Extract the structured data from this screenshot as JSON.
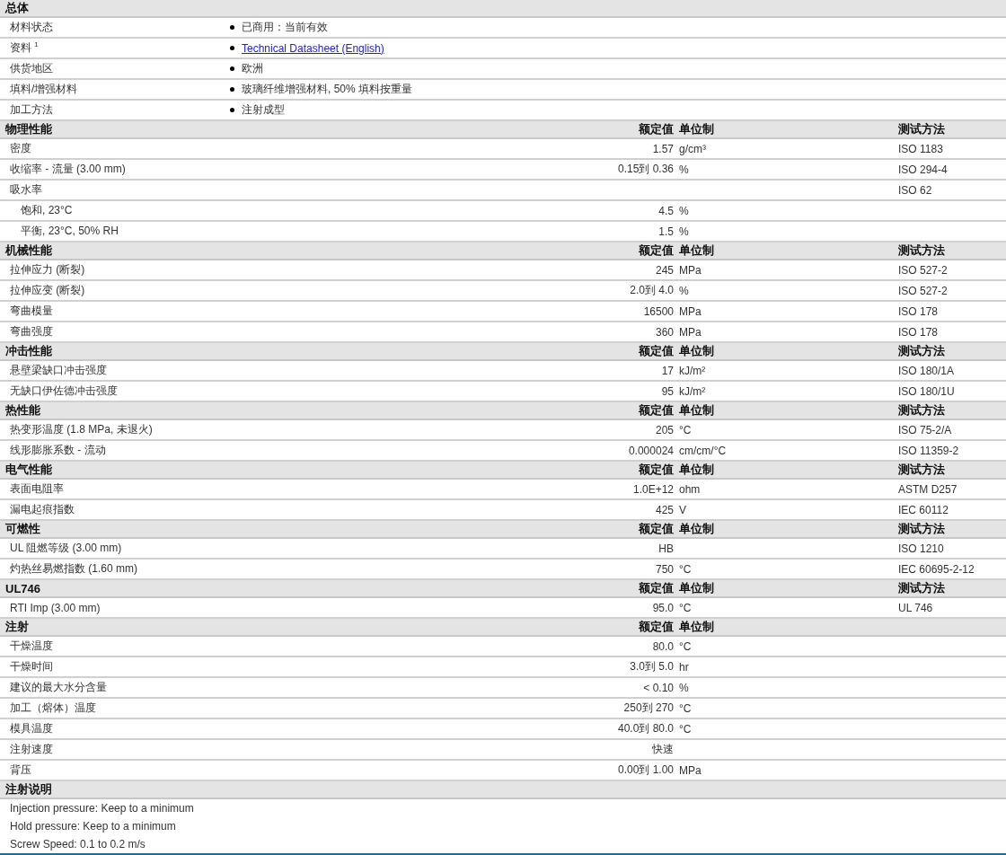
{
  "sections": [
    {
      "kind": "general",
      "title": "总体",
      "rows": [
        {
          "label": "材料状态",
          "value": "已商用：当前有效",
          "kind": "text"
        },
        {
          "label": "资料 $^{1}$",
          "value": "Technical Datasheet (English)",
          "kind": "link"
        },
        {
          "label": "供货地区",
          "value": "欧洲",
          "kind": "text"
        },
        {
          "label": "填料/增强材料",
          "value": "玻璃纤维增强材料, 50% 填料按重量",
          "kind": "text"
        },
        {
          "label": "加工方法",
          "value": "注射成型",
          "kind": "text"
        }
      ]
    },
    {
      "kind": "properties",
      "title": "物理性能",
      "headers": {
        "value": "额定值",
        "unit": "单位制",
        "method": "测试方法"
      },
      "rows": [
        {
          "label": "密度",
          "value": "1.57",
          "unit": "g/cm³",
          "method": "ISO 1183"
        },
        {
          "label": "收缩率  - 流量 (3.00 mm)",
          "value": "0.15到 0.36",
          "unit": "%",
          "method": "ISO 294-4"
        },
        {
          "label": "吸水率",
          "method": "ISO 62",
          "children": [
            {
              "label": "饱和, 23°C",
              "value": "4.5",
              "unit": "%"
            },
            {
              "label": "平衡, 23°C, 50% RH",
              "value": "1.5",
              "unit": "%"
            }
          ]
        }
      ]
    },
    {
      "kind": "properties",
      "title": "机械性能",
      "headers": {
        "value": "额定值",
        "unit": "单位制",
        "method": "测试方法"
      },
      "rows": [
        {
          "label": "拉伸应力 (断裂)",
          "value": "245",
          "unit": "MPa",
          "method": "ISO 527-2"
        },
        {
          "label": "拉伸应变 (断裂)",
          "value": "2.0到 4.0",
          "unit": "%",
          "method": "ISO 527-2"
        },
        {
          "label": "弯曲模量",
          "value": "16500",
          "unit": "MPa",
          "method": "ISO 178"
        },
        {
          "label": "弯曲强度",
          "value": "360",
          "unit": "MPa",
          "method": "ISO 178"
        }
      ]
    },
    {
      "kind": "properties",
      "title": "冲击性能",
      "headers": {
        "value": "额定值",
        "unit": "单位制",
        "method": "测试方法"
      },
      "rows": [
        {
          "label": "悬壁梁缺口冲击强度",
          "value": "17",
          "unit": "kJ/m²",
          "method": "ISO 180/1A"
        },
        {
          "label": "无缺口伊佐德冲击强度",
          "value": "95",
          "unit": "kJ/m²",
          "method": "ISO 180/1U"
        }
      ]
    },
    {
      "kind": "properties",
      "title": "热性能",
      "headers": {
        "value": "额定值",
        "unit": "单位制",
        "method": "测试方法"
      },
      "rows": [
        {
          "label": "热变形温度 (1.8 MPa, 未退火)",
          "value": "205",
          "unit": "°C",
          "method": "ISO 75-2/A"
        },
        {
          "label": "线形膨胀系数  - 流动",
          "value": "0.000024",
          "unit": "cm/cm/°C",
          "method": "ISO 11359-2"
        }
      ]
    },
    {
      "kind": "properties",
      "title": "电气性能",
      "headers": {
        "value": "额定值",
        "unit": "单位制",
        "method": "测试方法"
      },
      "rows": [
        {
          "label": "表面电阻率",
          "value": "1.0E+12",
          "unit": "ohm",
          "method": "ASTM D257"
        },
        {
          "label": "漏电起痕指数",
          "value": "425",
          "unit": "V",
          "method": "IEC 60112"
        }
      ]
    },
    {
      "kind": "properties",
      "title": "可燃性",
      "headers": {
        "value": "额定值",
        "unit": "单位制",
        "method": "测试方法"
      },
      "rows": [
        {
          "label": "UL 阻燃等级 (3.00 mm)",
          "value": "HB",
          "method": "ISO 1210"
        },
        {
          "label": "灼热丝易燃指数 (1.60 mm)",
          "value": "750",
          "unit": "°C",
          "method": "IEC 60695-2-12"
        }
      ]
    },
    {
      "kind": "properties",
      "title": "UL746",
      "headers": {
        "value": "额定值",
        "unit": "单位制",
        "method": "测试方法"
      },
      "rows": [
        {
          "label": "RTI Imp (3.00 mm)",
          "value": "95.0",
          "unit": "°C",
          "method": "UL 746"
        }
      ]
    },
    {
      "kind": "properties",
      "title": "注射",
      "headers": {
        "value": "额定值",
        "unit": "单位制"
      },
      "rows": [
        {
          "label": "干燥温度",
          "value": "80.0",
          "unit": "°C"
        },
        {
          "label": "干燥时间",
          "value": "3.0到 5.0",
          "unit": "hr"
        },
        {
          "label": "建议的最大水分含量",
          "value": "< 0.10",
          "unit": "%"
        },
        {
          "label": "加工（熔体）温度",
          "value": "250到 270",
          "unit": "°C"
        },
        {
          "label": "模具温度",
          "value": "40.0到 80.0",
          "unit": "°C"
        },
        {
          "label": "注射速度",
          "value": "快速"
        },
        {
          "label": "背压",
          "value": "0.00到 1.00",
          "unit": "MPa"
        }
      ]
    },
    {
      "kind": "notes",
      "title": "注射说明",
      "lines": [
        "Injection pressure: Keep to a minimum",
        "Hold pressure: Keep to a minimum",
        "Screw Speed: 0.1 to 0.2 m/s"
      ]
    }
  ]
}
